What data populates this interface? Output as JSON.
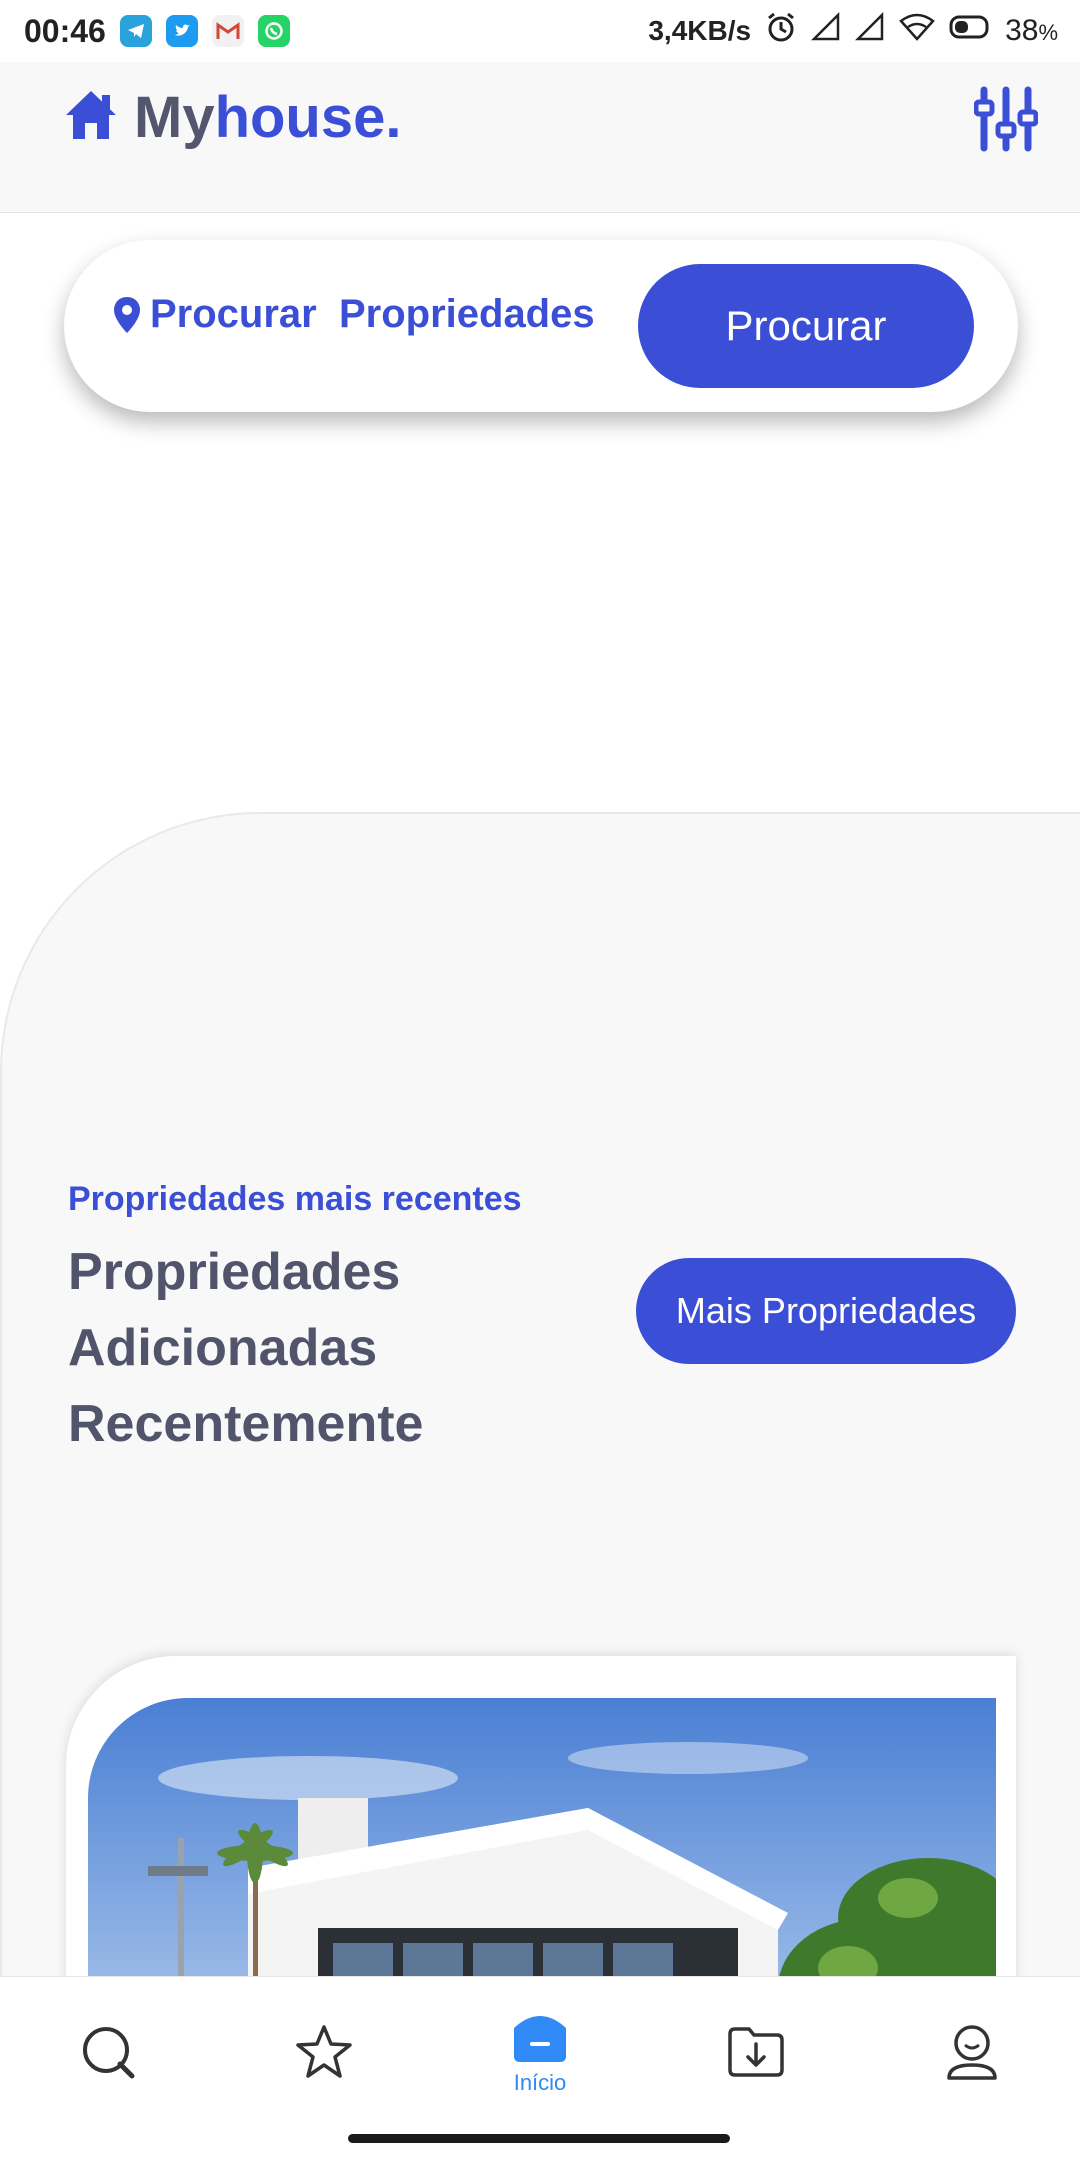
{
  "status_bar": {
    "time": "00:46",
    "speed": "3,4KB/s",
    "battery": "38",
    "battery_unit": "%",
    "notification_icons": [
      "telegram-icon",
      "twitter-icon",
      "gmail-icon",
      "whatsapp-icon"
    ]
  },
  "header": {
    "logo_my": "My",
    "logo_house": "house.",
    "accent_color": "#3a4fd6"
  },
  "search": {
    "label": "Procurar  Propriedades",
    "button_label": "Procurar"
  },
  "recent": {
    "kicker": "Propriedades mais recentes",
    "title_line1": "Propriedades",
    "title_line2": "Adicionadas",
    "title_line3": "Recentemente",
    "more_button": "Mais Propriedades"
  },
  "bottom_nav": {
    "items": [
      {
        "icon": "search-icon",
        "label": ""
      },
      {
        "icon": "star-icon",
        "label": ""
      },
      {
        "icon": "home-icon",
        "label": "Início"
      },
      {
        "icon": "download-folder-icon",
        "label": ""
      },
      {
        "icon": "profile-icon",
        "label": ""
      }
    ]
  }
}
